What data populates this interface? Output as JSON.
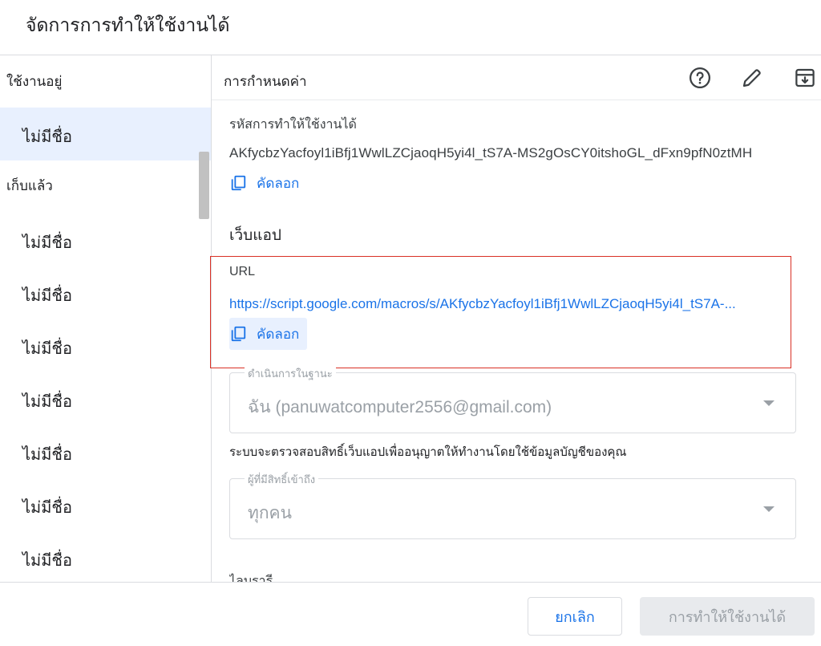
{
  "dialog": {
    "title": "จัดการการทำให้ใช้งานได้"
  },
  "sidebar": {
    "active_heading": "ใช้งานอยู่",
    "active_items": [
      {
        "label": "ไม่มีชื่อ"
      }
    ],
    "archived_heading": "เก็บแล้ว",
    "archived_items": [
      {
        "label": "ไม่มีชื่อ"
      },
      {
        "label": "ไม่มีชื่อ"
      },
      {
        "label": "ไม่มีชื่อ"
      },
      {
        "label": "ไม่มีชื่อ"
      },
      {
        "label": "ไม่มีชื่อ"
      },
      {
        "label": "ไม่มีชื่อ"
      },
      {
        "label": "ไม่มีชื่อ"
      }
    ]
  },
  "main": {
    "header_label": "การกำหนดค่า",
    "icons": [
      "help-icon",
      "edit-pencil-icon",
      "archive-icon"
    ],
    "deployment_id_label": "รหัสการทำให้ใช้งานได้",
    "deployment_id": "AKfycbzYacfoyl1iBfj1WwlLZCjaoqH5yi4l_tS7A-MS2gOsCY0itshoGL_dFxn9pfN0ztMH",
    "copy_label": "คัดลอก",
    "web_app_title": "เว็บแอป",
    "url_label": "URL",
    "url_value": "https://script.google.com/macros/s/AKfycbzYacfoyl1iBfj1WwlLZCjaoqH5yi4l_tS7A-...",
    "url_copy_label": "คัดลอก",
    "execute_as": {
      "legend": "ดำเนินการในฐานะ",
      "value": "ฉัน (panuwatcomputer2556@gmail.com)"
    },
    "execute_help": "ระบบจะตรวจสอบสิทธิ์เว็บแอปเพื่ออนุญาตให้ทำงานโดยใช้ข้อมูลบัญชีของคุณ",
    "who_has_access": {
      "legend": "ผู้ที่มีสิทธิ์เข้าถึง",
      "value": "ทุกคน"
    },
    "cutoff_label": "ไลบรารี"
  },
  "footer": {
    "cancel_label": "ยกเลิก",
    "deploy_label": "การทำให้ใช้งานได้"
  },
  "colors": {
    "accent": "#1a73e8",
    "active_row_bg": "#e8f0fe",
    "highlight_border": "#d93025",
    "disabled_text": "#9aa0a6"
  }
}
